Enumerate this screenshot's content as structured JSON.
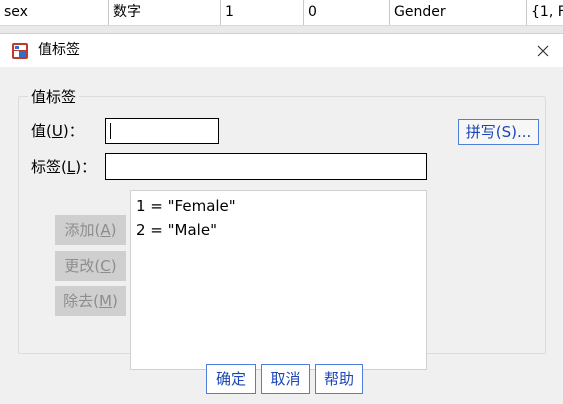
{
  "background_row": {
    "cells": [
      "sex",
      "数字",
      "1",
      "0",
      "Gender",
      "{1, F"
    ]
  },
  "dialog": {
    "title": "值标签",
    "group_label": "值标签",
    "value_label_prefix": "值(",
    "value_label_key": "U",
    "value_label_suffix": ")：",
    "label_label_prefix": "标签(",
    "label_label_key": "L",
    "label_label_suffix": ")：",
    "value_input_value": "",
    "label_input_value": "",
    "spell_button": "拼写(S)...",
    "add_button_prefix": "添加(",
    "add_button_key": "A",
    "change_button_prefix": "更改(",
    "change_button_key": "C",
    "remove_button_prefix": "除去(",
    "remove_button_key": "M",
    "button_suffix": ")",
    "list_items": [
      "1 = \"Female\"",
      "2 = \"Male\""
    ],
    "ok_button": "确定",
    "cancel_button": "取消",
    "help_button": "帮助"
  },
  "colors": {
    "accent_border": "#4f7fd6",
    "accent_text": "#1b46b4",
    "disabled_bg": "#cfcfcf",
    "disabled_text": "#8d8d8d"
  }
}
